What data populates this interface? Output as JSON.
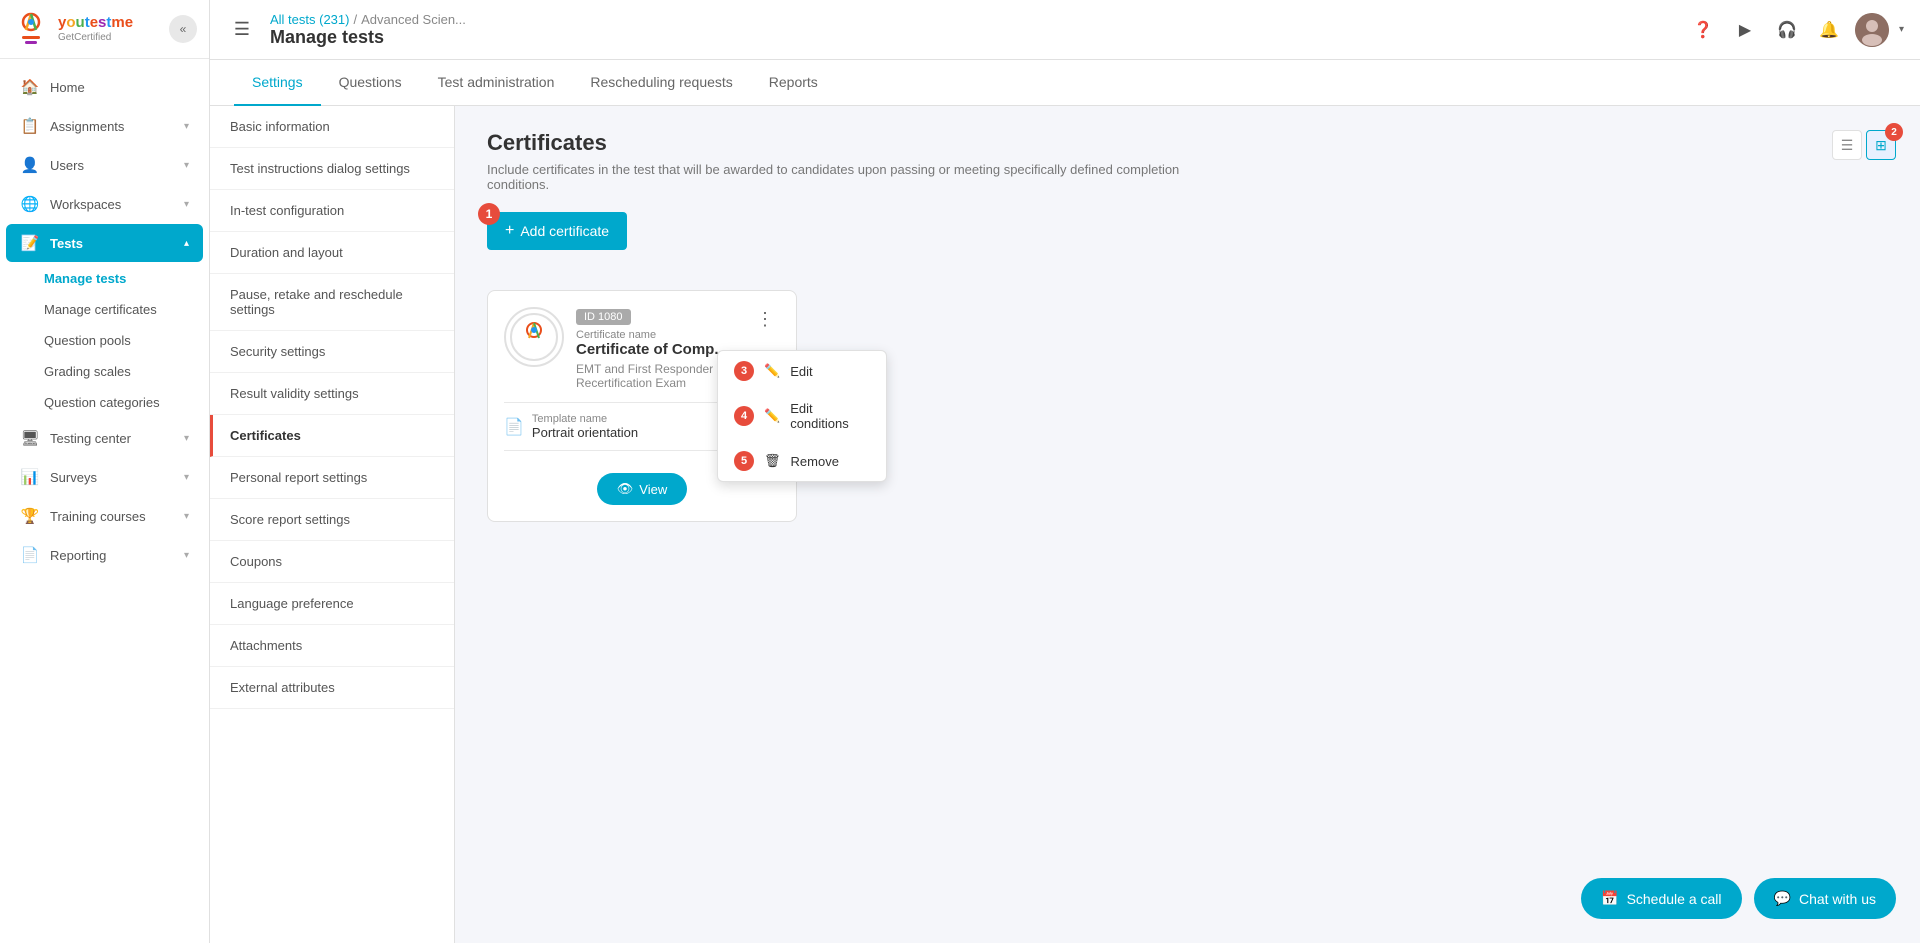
{
  "app": {
    "name": "youtestme",
    "tagline": "GetCertified"
  },
  "topbar": {
    "hamburger_label": "☰",
    "breadcrumb": {
      "all_tests": "All tests (231)",
      "separator": "/",
      "current": "Advanced Scien..."
    },
    "page_title": "Manage tests"
  },
  "sidebar": {
    "collapse_icon": "«",
    "items": [
      {
        "id": "home",
        "label": "Home",
        "icon": "🏠",
        "arrow": ""
      },
      {
        "id": "assignments",
        "label": "Assignments",
        "icon": "📋",
        "arrow": "▾"
      },
      {
        "id": "users",
        "label": "Users",
        "icon": "👤",
        "arrow": "▾"
      },
      {
        "id": "workspaces",
        "label": "Workspaces",
        "icon": "🌐",
        "arrow": "▾"
      },
      {
        "id": "tests",
        "label": "Tests",
        "icon": "📝",
        "arrow": "▴",
        "active": true
      },
      {
        "id": "testing-center",
        "label": "Testing center",
        "icon": "🖥",
        "arrow": "▾"
      },
      {
        "id": "surveys",
        "label": "Surveys",
        "icon": "📊",
        "arrow": "▾"
      },
      {
        "id": "training-courses",
        "label": "Training courses",
        "icon": "🏆",
        "arrow": "▾"
      },
      {
        "id": "reporting",
        "label": "Reporting",
        "icon": "📄",
        "arrow": "▾"
      }
    ],
    "sub_items": [
      {
        "id": "manage-tests",
        "label": "Manage tests",
        "active": true
      },
      {
        "id": "manage-certificates",
        "label": "Manage certificates"
      },
      {
        "id": "question-pools",
        "label": "Question pools"
      },
      {
        "id": "grading-scales",
        "label": "Grading scales"
      },
      {
        "id": "question-categories",
        "label": "Question categories"
      }
    ]
  },
  "tabs": [
    {
      "id": "settings",
      "label": "Settings",
      "active": true
    },
    {
      "id": "questions",
      "label": "Questions"
    },
    {
      "id": "test-administration",
      "label": "Test administration"
    },
    {
      "id": "rescheduling-requests",
      "label": "Rescheduling requests"
    },
    {
      "id": "reports",
      "label": "Reports"
    }
  ],
  "settings_nav": [
    {
      "id": "basic-information",
      "label": "Basic information"
    },
    {
      "id": "test-instructions",
      "label": "Test instructions dialog settings"
    },
    {
      "id": "in-test-configuration",
      "label": "In-test configuration"
    },
    {
      "id": "duration-and-layout",
      "label": "Duration and layout"
    },
    {
      "id": "pause-retake-reschedule",
      "label": "Pause, retake and reschedule settings"
    },
    {
      "id": "security-settings",
      "label": "Security settings"
    },
    {
      "id": "result-validity-settings",
      "label": "Result validity settings"
    },
    {
      "id": "certificates",
      "label": "Certificates",
      "active": true
    },
    {
      "id": "personal-report-settings",
      "label": "Personal report settings"
    },
    {
      "id": "score-report-settings",
      "label": "Score report settings"
    },
    {
      "id": "coupons",
      "label": "Coupons"
    },
    {
      "id": "language-preference",
      "label": "Language preference"
    },
    {
      "id": "attachments",
      "label": "Attachments"
    },
    {
      "id": "external-attributes",
      "label": "External attributes"
    }
  ],
  "certificates": {
    "title": "Certificates",
    "subtitle": "Include certificates in the test that will be awarded to candidates upon passing or meeting specifically defined completion conditions.",
    "add_button_label": "Add certificate",
    "add_badge": "1",
    "view_toggle_badge": "2",
    "card": {
      "id_badge": "ID 1080",
      "name_label": "Certificate name",
      "name": "Certificate of Comp...",
      "test_name": "EMT and First Responder Recertification Exam",
      "template_label": "Template name",
      "template_name": "Portrait orientation",
      "view_button_label": "View"
    },
    "context_menu": {
      "items": [
        {
          "id": "edit",
          "label": "Edit",
          "badge": "3",
          "icon": "✏️"
        },
        {
          "id": "edit-conditions",
          "label": "Edit conditions",
          "badge": "4",
          "icon": "✏️"
        },
        {
          "id": "remove",
          "label": "Remove",
          "badge": "5",
          "icon": "🗑"
        }
      ]
    }
  },
  "bottom_actions": {
    "schedule_call": "Schedule a call",
    "chat_with_us": "Chat with us"
  }
}
